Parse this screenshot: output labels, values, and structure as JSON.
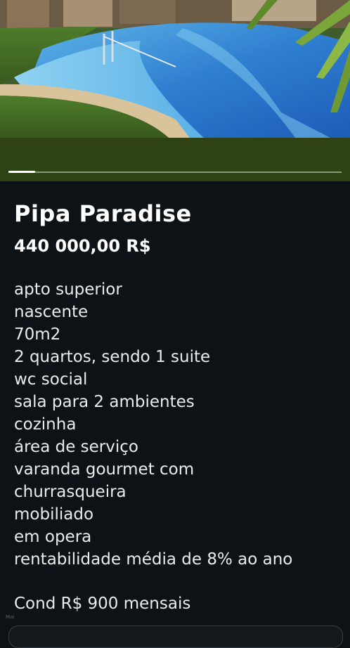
{
  "listing": {
    "title": "Pipa Paradise",
    "price": "440 000,00 R$",
    "description_lines": [
      "apto superior",
      "nascente",
      "70m2",
      "2 quartos, sendo 1 suite",
      "wc social",
      "sala para 2 ambientes",
      "cozinha",
      "área de serviço",
      "varanda gourmet com",
      "churrasqueira",
      "mobiliado",
      "em opera",
      "rentabilidade média de 8% ao ano"
    ],
    "condo_fee": "Cond R$ 900 mensais"
  },
  "gallery": {
    "photo_description": "pool-photo",
    "progress_fraction": 0.08
  },
  "footer": {
    "tiny_label": "Mai"
  },
  "colors": {
    "background": "#0d1216",
    "progress_band": "#2e4214",
    "text": "#ffffff"
  }
}
